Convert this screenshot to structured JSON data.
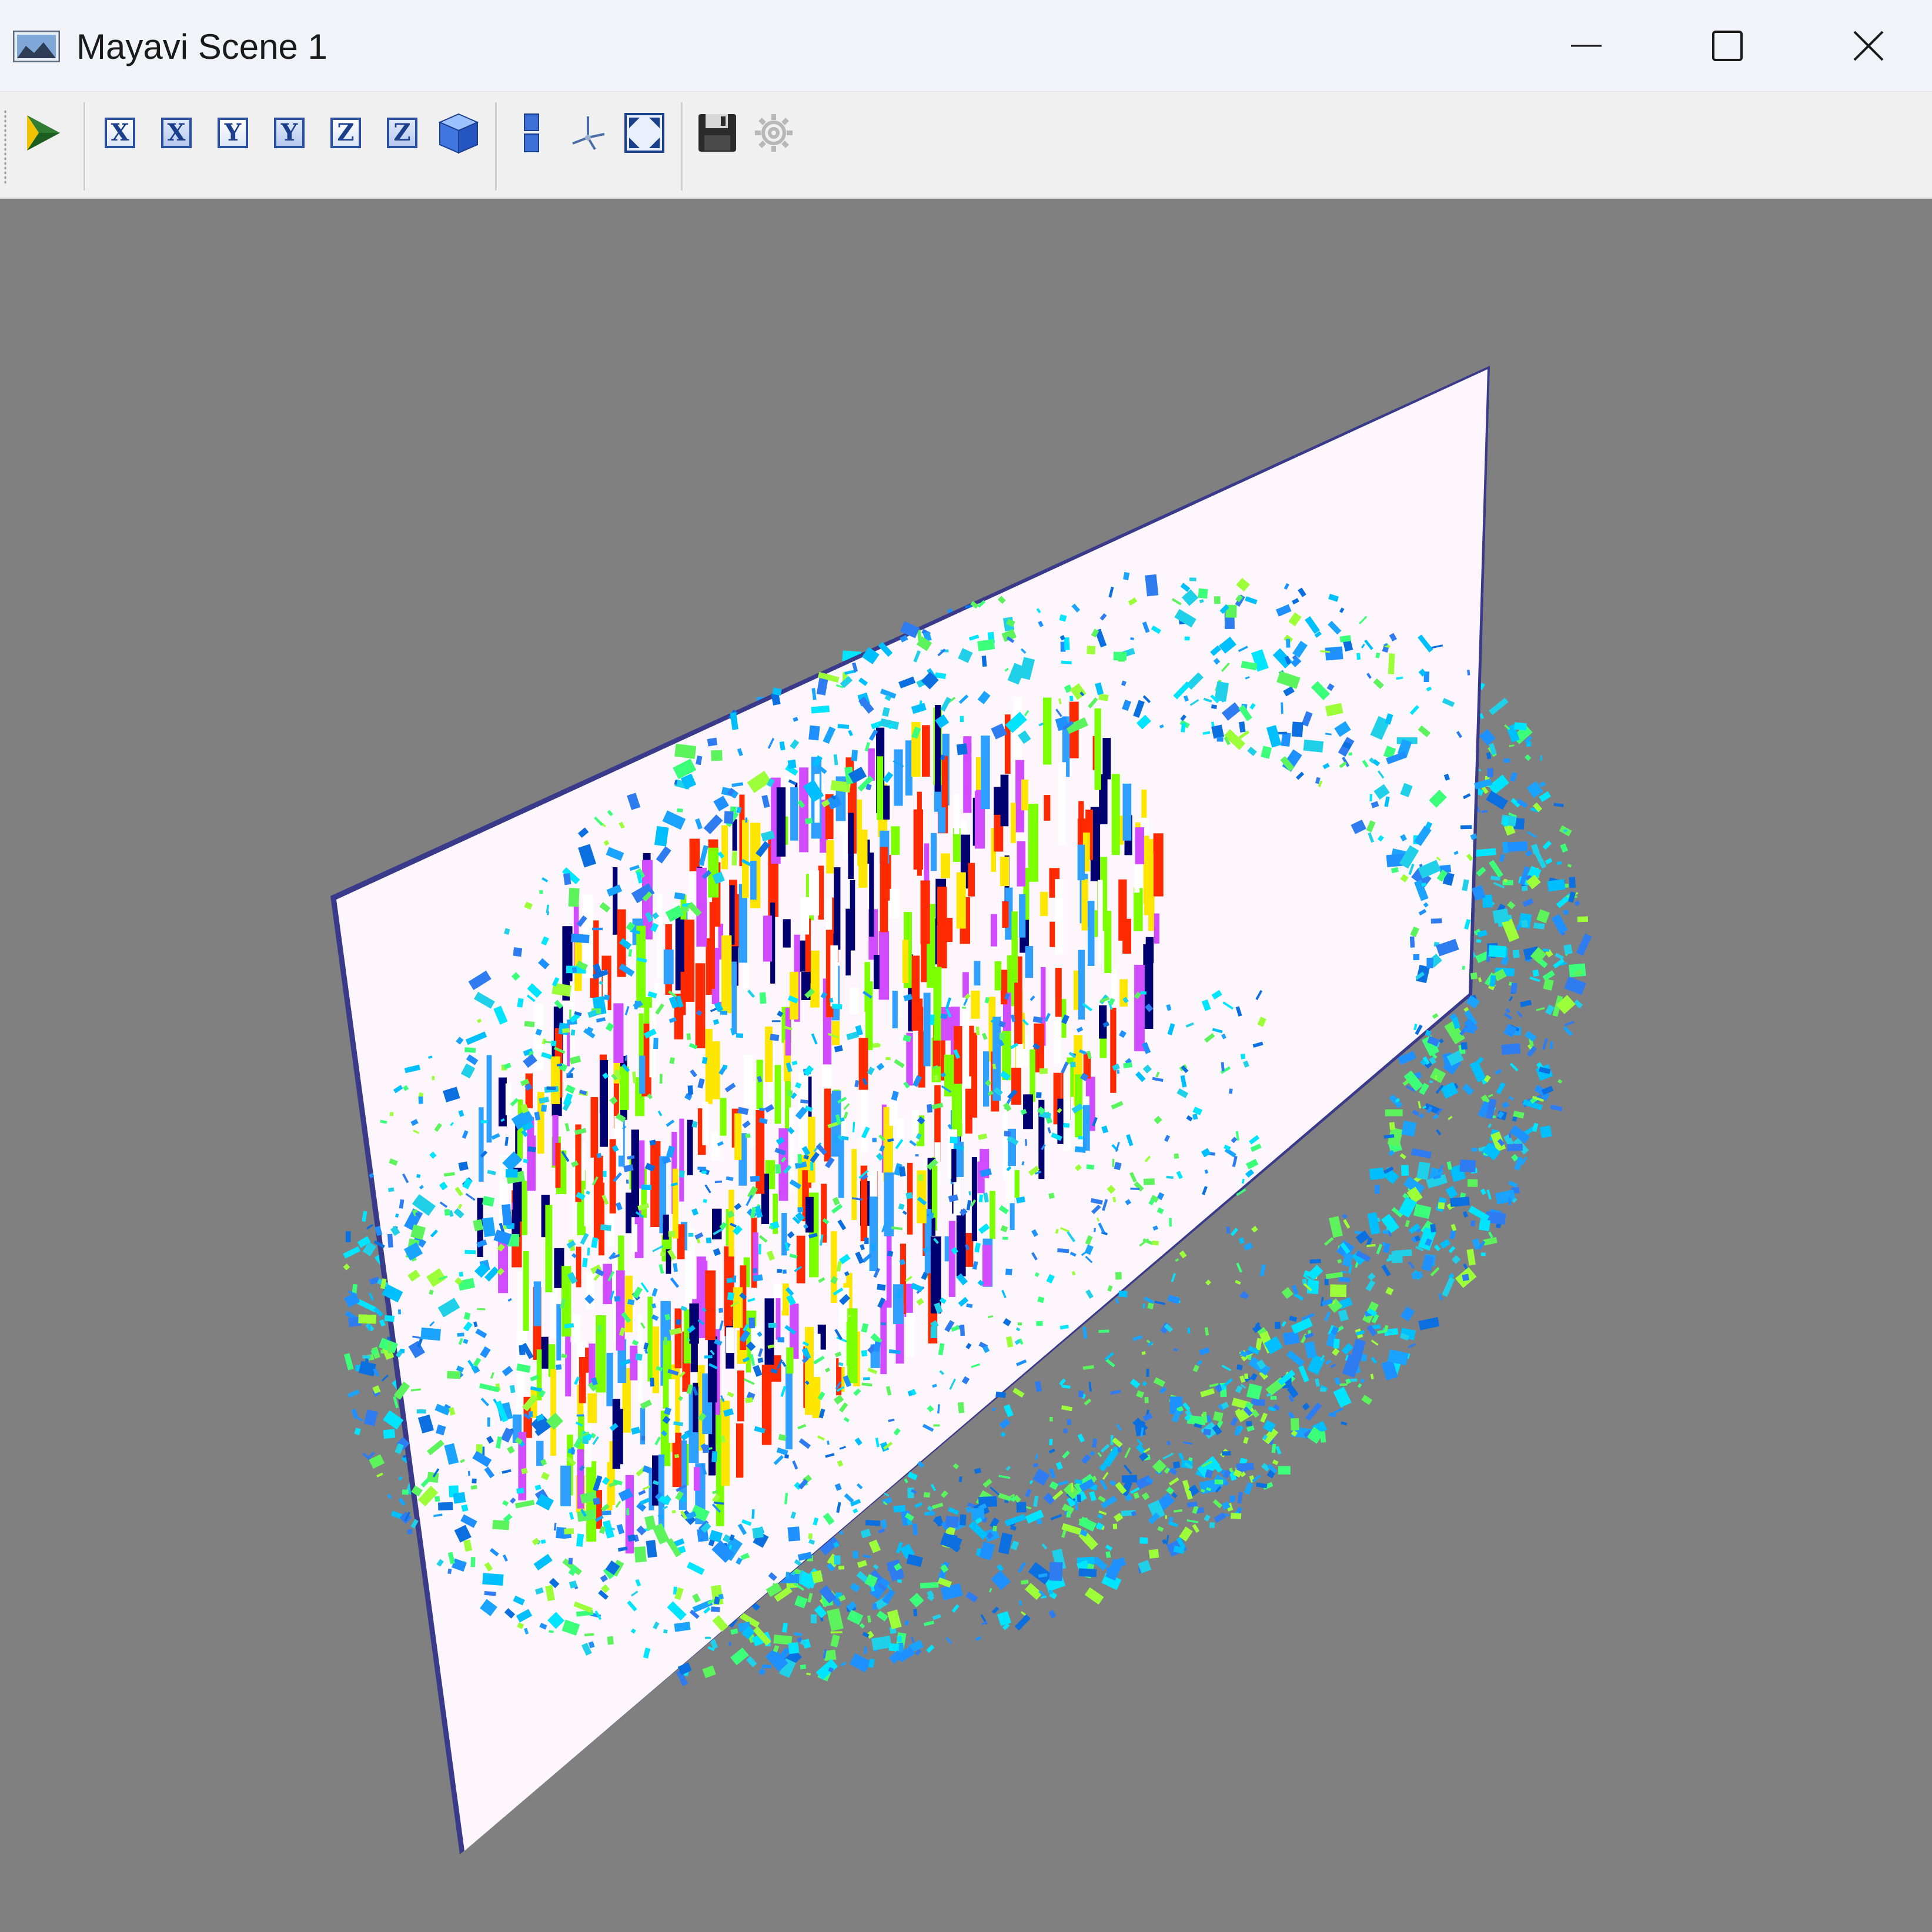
{
  "window": {
    "title": "Mayavi Scene 1",
    "icon": "mayavi-scene-icon",
    "controls": {
      "minimize_icon": "minimize-icon",
      "maximize_icon": "maximize-icon",
      "close_icon": "close-icon"
    }
  },
  "toolbar": {
    "buttons": [
      {
        "icon": "mayavi-engine-icon",
        "group": 1
      },
      {
        "icon": "view-x-plus-icon",
        "glyph": "X",
        "group": 2
      },
      {
        "icon": "view-x-minus-icon",
        "glyph": "X",
        "group": 2
      },
      {
        "icon": "view-y-plus-icon",
        "glyph": "Y",
        "group": 2
      },
      {
        "icon": "view-y-minus-icon",
        "glyph": "Y",
        "group": 2
      },
      {
        "icon": "view-z-plus-icon",
        "glyph": "Z",
        "group": 2
      },
      {
        "icon": "view-z-minus-icon",
        "glyph": "Z",
        "group": 2
      },
      {
        "icon": "isometric-view-icon",
        "group": 2
      },
      {
        "icon": "parallel-projection-icon",
        "group": 3
      },
      {
        "icon": "axes-indicator-icon",
        "group": 3
      },
      {
        "icon": "full-screen-icon",
        "group": 3
      },
      {
        "icon": "save-scene-icon",
        "group": 4
      },
      {
        "icon": "configure-scene-icon",
        "group": 4
      }
    ]
  },
  "scene": {
    "background_color": "#808080",
    "plane_color": "#fdf6fd",
    "plane_edge_color": "#3a3a8a",
    "glyph_colors": [
      "#1e90ff",
      "#00bfff",
      "#1aa3ff",
      "#0b6fe0",
      "#2f7cf0",
      "#00e5ff",
      "#20d0e8",
      "#3cff7a",
      "#5cf35c",
      "#9cff3a"
    ],
    "bar_colors": [
      "#000070",
      "#ff2a00",
      "#ffe600",
      "#7cff00",
      "#d24cff",
      "#2fa0ff",
      "#ffffff"
    ]
  }
}
